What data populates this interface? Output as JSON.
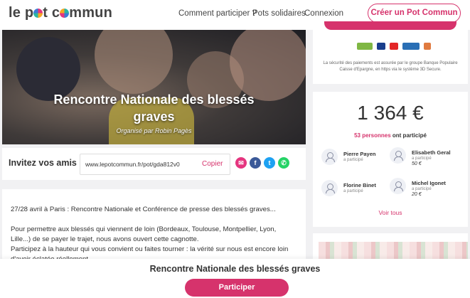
{
  "header": {
    "logo": "le pot commun",
    "nav": [
      "Comment participer ?",
      "Pots solidaires",
      "Connexion"
    ],
    "cta": "Créer un Pot Commun"
  },
  "hero": {
    "title": "Rencontre Nationale des blessés graves",
    "organizer": "Organisé par Robin Pagès"
  },
  "invite": {
    "label": "Invitez vos amis",
    "url": "www.lepotcommun.fr/pot/gda812v0",
    "copy": "Copier",
    "share_icons": [
      "email-icon",
      "facebook-icon",
      "twitter-icon",
      "whatsapp-icon"
    ]
  },
  "description": {
    "p1": "27/28 avril à Paris : Rencontre Nationale et Conférence de presse des blessés graves...",
    "p2": "Pour permettre aux blessés qui viennent de loin (Bordeaux, Toulouse, Montpellier, Lyon, Lille...) de se payer le trajet, nous avons ouvert cette cagnotte.",
    "p3": "Participez à la hauteur qui vous convient ou faites tourner : la vérité sur nous est encore loin d'avoir éclatée réellement."
  },
  "payment": {
    "text": "La sécurité des paiements est assurée par le groupe Banque Populaire Caisse d'Epargne, en https via le système 3D Secure."
  },
  "total": {
    "amount": "1 364 €",
    "count": "53 personnes",
    "count_suffix": " ont participé",
    "participants": [
      {
        "name": "Pierre Payen",
        "sub": "a participé",
        "amount": ""
      },
      {
        "name": "Elisabeth Geral",
        "sub": "a participé",
        "amount": "50 €"
      },
      {
        "name": "Florine Binet",
        "sub": "a participé",
        "amount": ""
      },
      {
        "name": "Michel Igonet",
        "sub": "a participé",
        "amount": "20 €"
      }
    ],
    "see_all": "Voir tous"
  },
  "bottom": {
    "title": "Rencontre Nationale des blessés graves",
    "button": "Participer"
  },
  "colors": {
    "accent": "#d6336c",
    "background": "#f1f1f3"
  }
}
